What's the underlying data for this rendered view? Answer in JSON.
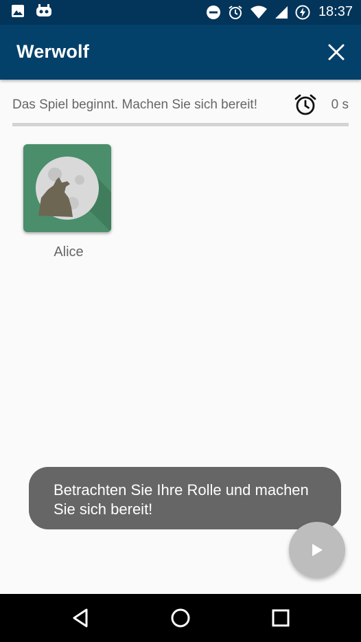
{
  "status_bar": {
    "time": "18:37",
    "icons": [
      "image-notification-icon",
      "android-notification-icon",
      "do-not-disturb-icon",
      "alarm-icon",
      "wifi-icon",
      "signal-icon",
      "battery-charging-icon"
    ]
  },
  "app_bar": {
    "title": "Werwolf",
    "close_icon": "close-icon"
  },
  "game": {
    "status_message": "Das Spiel beginnt. Machen Sie sich bereit!",
    "timer_icon": "alarm-clock-icon",
    "timer_value": "0 s",
    "progress_fraction": 0
  },
  "players": [
    {
      "name": "Alice",
      "avatar_icon": "wolf-moon-icon"
    }
  ],
  "toast": {
    "message": "Betrachten Sie Ihre Rolle und machen Sie sich bereit!"
  },
  "fab": {
    "icon": "play-icon"
  },
  "nav_bar": {
    "icons": [
      "back-icon",
      "home-icon",
      "recents-icon"
    ]
  },
  "colors": {
    "app_bar": "#03416b",
    "status_bar": "#03355a",
    "avatar_bg": "#4a8e6b",
    "toast_bg": "#666666",
    "fab_bg": "#bdbdbd"
  }
}
